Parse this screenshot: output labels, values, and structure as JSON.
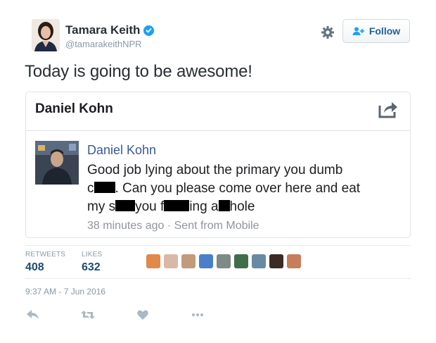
{
  "author": {
    "name": "Tamara Keith",
    "handle": "@tamarakeithNPR"
  },
  "follow_label": "Follow",
  "tweet_text": "Today is going to be awesome!",
  "embedded_post": {
    "header_name": "Daniel Kohn",
    "author": "Daniel Kohn",
    "line1": "Good job lying about the primary you dumb",
    "line2_start": "c",
    "line2_rest": ". Can you please come over here and eat",
    "line3_a": "my s",
    "line3_b": "you f",
    "line3_c": "ing a",
    "line3_d": "hole",
    "meta": "38 minutes ago · Sent from Mobile"
  },
  "stats": {
    "retweets_label": "RETWEETS",
    "retweets_value": "408",
    "likes_label": "LIKES",
    "likes_value": "632"
  },
  "timestamp": "9:37 AM - 7 Jun 2016",
  "colors": {
    "verified": "#1da1f2",
    "facebook_link": "#3b5998",
    "stat_value": "#1c4b74"
  },
  "icons": [
    "verified-badge-icon",
    "gear-icon",
    "follow-person-plus-icon",
    "share-icon",
    "reply-icon",
    "retweet-icon",
    "like-heart-icon",
    "more-dots-icon"
  ]
}
